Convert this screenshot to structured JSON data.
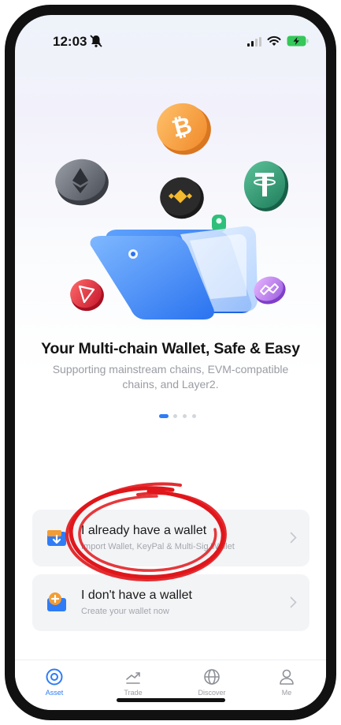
{
  "status_bar": {
    "time": "12:03"
  },
  "onboarding": {
    "title": "Your Multi-chain Wallet, Safe & Easy",
    "subtitle": "Supporting mainstream chains, EVM-compatible chains, and Layer2.",
    "page_index": 1,
    "page_count": 4
  },
  "options": [
    {
      "title": "I already have a wallet",
      "subtitle": "Import Wallet, KeyPal & Multi-Sig Wallet",
      "icon": "import-wallet-icon"
    },
    {
      "title": "I don't have a wallet",
      "subtitle": "Create your wallet now",
      "icon": "create-wallet-icon"
    }
  ],
  "tab_bar": {
    "items": [
      {
        "label": "Asset",
        "icon": "asset-icon",
        "active": true
      },
      {
        "label": "Trade",
        "icon": "trade-icon",
        "active": false
      },
      {
        "label": "Discover",
        "icon": "discover-icon",
        "active": false
      },
      {
        "label": "Me",
        "icon": "me-icon",
        "active": false
      }
    ]
  },
  "colors": {
    "accent": "#2f7cf6",
    "annotation": "#e0161b",
    "card_bg": "#f3f4f6",
    "import_icon": "#f39c33",
    "create_icon": "#f39c33"
  },
  "hero_coins": [
    "bitcoin-coin",
    "ethereum-coin",
    "bnb-coin",
    "tether-coin",
    "tron-coin",
    "polygon-coin"
  ]
}
